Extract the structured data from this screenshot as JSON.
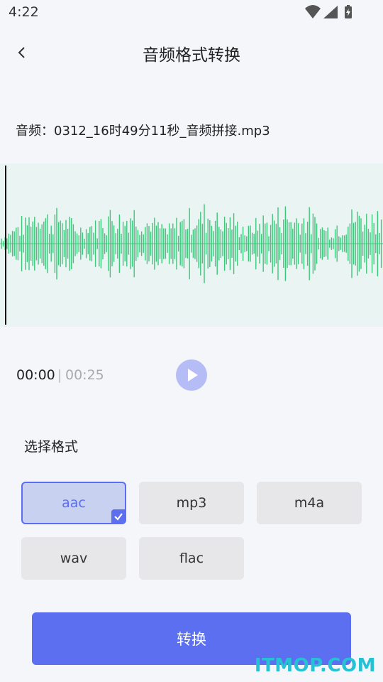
{
  "status_bar": {
    "time": "4:22"
  },
  "header": {
    "title": "音频格式转换"
  },
  "audio": {
    "file_label": "音频：0312_16时49分11秒_音频拼接.mp3"
  },
  "player": {
    "current_time": "00:00",
    "separator": "|",
    "total_time": "00:25"
  },
  "formats": {
    "label": "选择格式",
    "options": [
      {
        "label": "aac",
        "selected": true
      },
      {
        "label": "mp3",
        "selected": false
      },
      {
        "label": "m4a",
        "selected": false
      },
      {
        "label": "wav",
        "selected": false
      },
      {
        "label": "flac",
        "selected": false
      }
    ]
  },
  "actions": {
    "convert_label": "转换"
  },
  "watermark": {
    "text": "ITMOP.COM"
  },
  "colors": {
    "accent": "#5b6ff0",
    "waveform": "#3cc77a",
    "waveform_bg": "#eaf4f2"
  }
}
